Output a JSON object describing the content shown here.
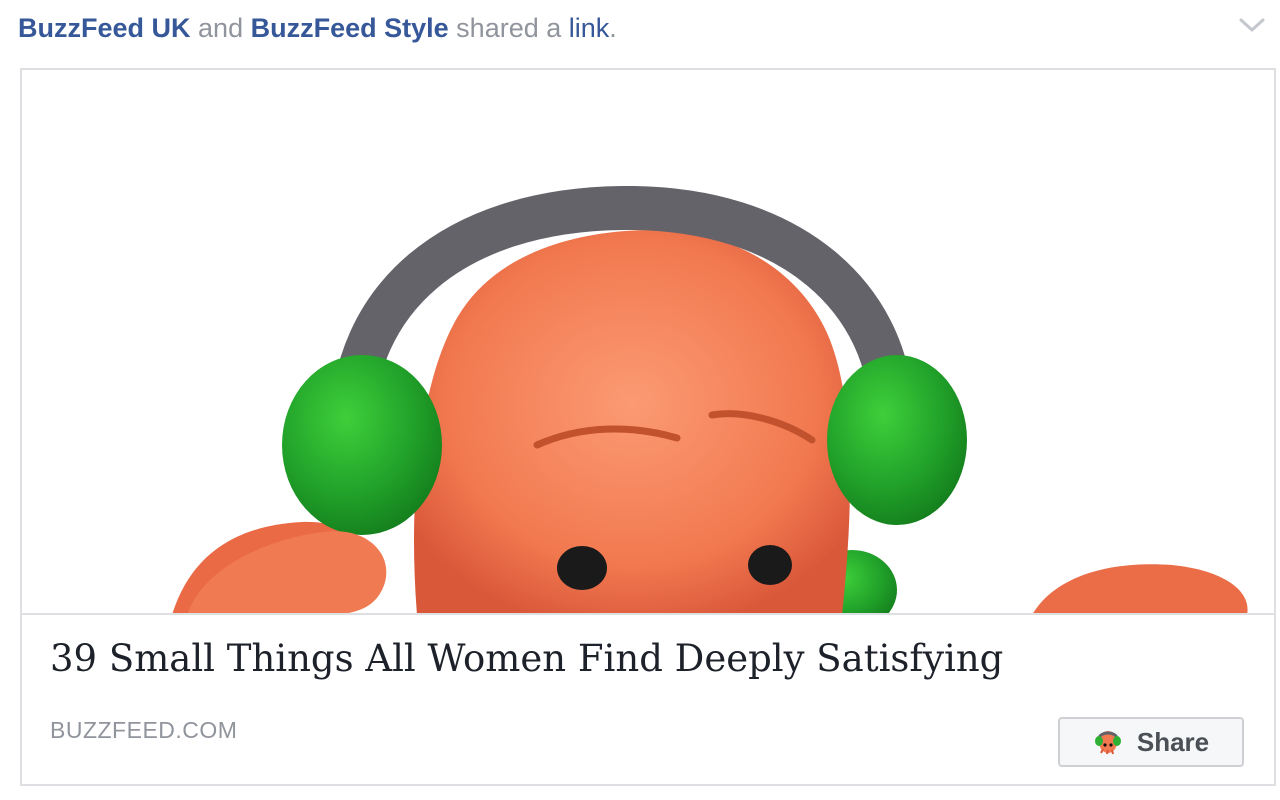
{
  "post_header": {
    "page1": "BuzzFeed UK",
    "and": "and",
    "page2": "BuzzFeed Style",
    "shared_a": "shared a",
    "link": "link",
    "period": "."
  },
  "link_card": {
    "title": "39 Small Things All Women Find Deeply Satisfying",
    "domain": "BUZZFEED.COM",
    "share_label": "Share",
    "image_icon": "octopus-with-headphones-image"
  },
  "icons": {
    "chevron": "chevron-down-icon",
    "share": "octopus-share-icon"
  },
  "colors": {
    "link_blue": "#365899",
    "muted_gray": "#90949c",
    "headphone_green": "#2eb034",
    "skin_orange": "#f37a56"
  }
}
